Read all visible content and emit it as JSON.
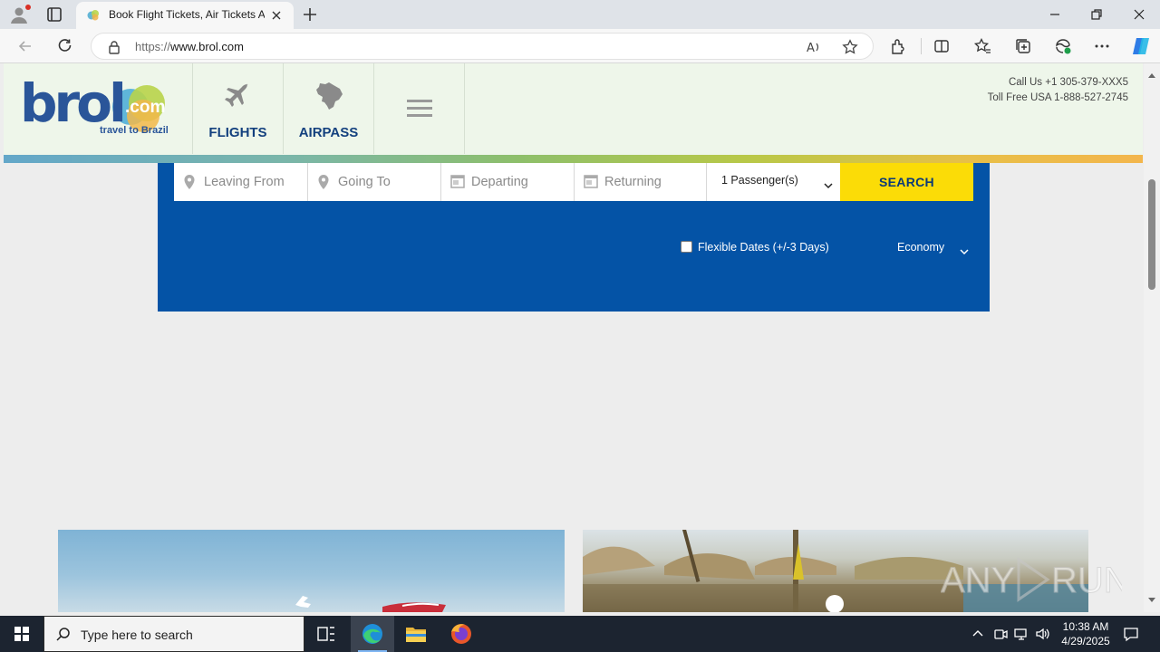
{
  "browser": {
    "tab_title": "Book Flight Tickets, Air Tickets Ai",
    "url_prefix": "https://",
    "url_host": "www.brol.com"
  },
  "header": {
    "logo_word": "brol",
    "logo_suffix": ".com",
    "logo_tagline": "travel to Brazil",
    "nav": [
      {
        "label": "FLIGHTS",
        "icon": "plane-icon"
      },
      {
        "label": "AIRPASS",
        "icon": "brazil-map-icon"
      },
      {
        "label": "",
        "icon": "hamburger-menu-icon"
      }
    ],
    "call_us": "Call Us +1 305-379-XXX5",
    "toll_free": "Toll Free USA 1-888-527-2745"
  },
  "search": {
    "leaving_from_placeholder": "Leaving From",
    "going_to_placeholder": "Going To",
    "departing_placeholder": "Departing",
    "returning_placeholder": "Returning",
    "passengers": "1 Passenger(s)",
    "search_label": "SEARCH",
    "flexible_dates_label": "Flexible Dates (+/-3 Days)",
    "flexible_dates_checked": false,
    "cabin_class": "Economy"
  },
  "taskbar": {
    "search_placeholder": "Type here to search",
    "time": "10:38 AM",
    "date": "4/29/2025"
  },
  "colors": {
    "panel_blue": "#0453a6",
    "search_yellow": "#fbdc07",
    "header_bg": "#eef6ea",
    "brand_navy": "#2a5599"
  }
}
